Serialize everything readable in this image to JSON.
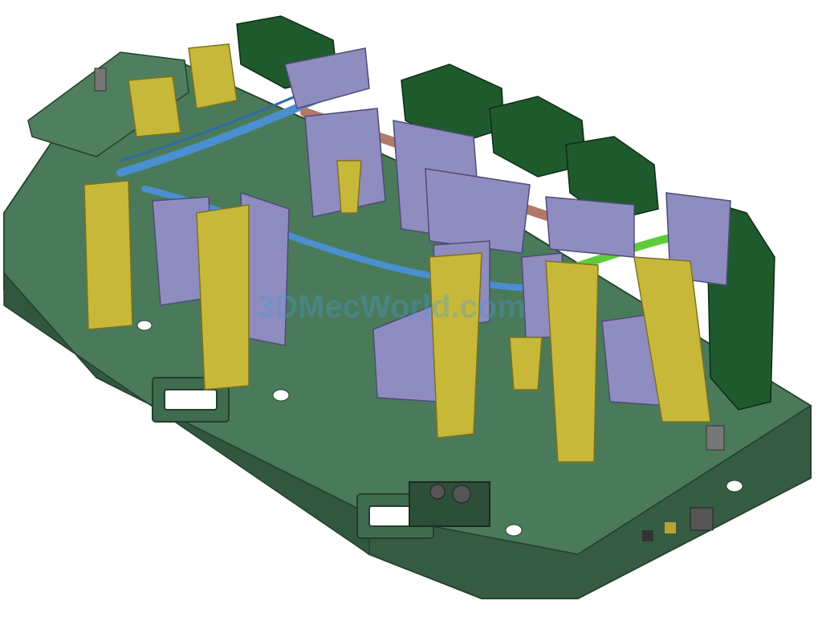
{
  "watermark": {
    "text": "3DMecWorld.com"
  },
  "colors": {
    "base_plate": "#3f6b4e",
    "base_edge": "#24402d",
    "base_light": "#4f7f5f",
    "clamp_yellow": "#c8b83a",
    "clamp_yellow_dark": "#8f8222",
    "support_purple": "#8f8cc0",
    "support_purple_dark": "#5e5b8c",
    "dark_green_unit": "#1f5a2c",
    "part_blue": "#4a8fd0",
    "part_copper": "#b07a6a",
    "part_lime": "#5ecb3a"
  }
}
